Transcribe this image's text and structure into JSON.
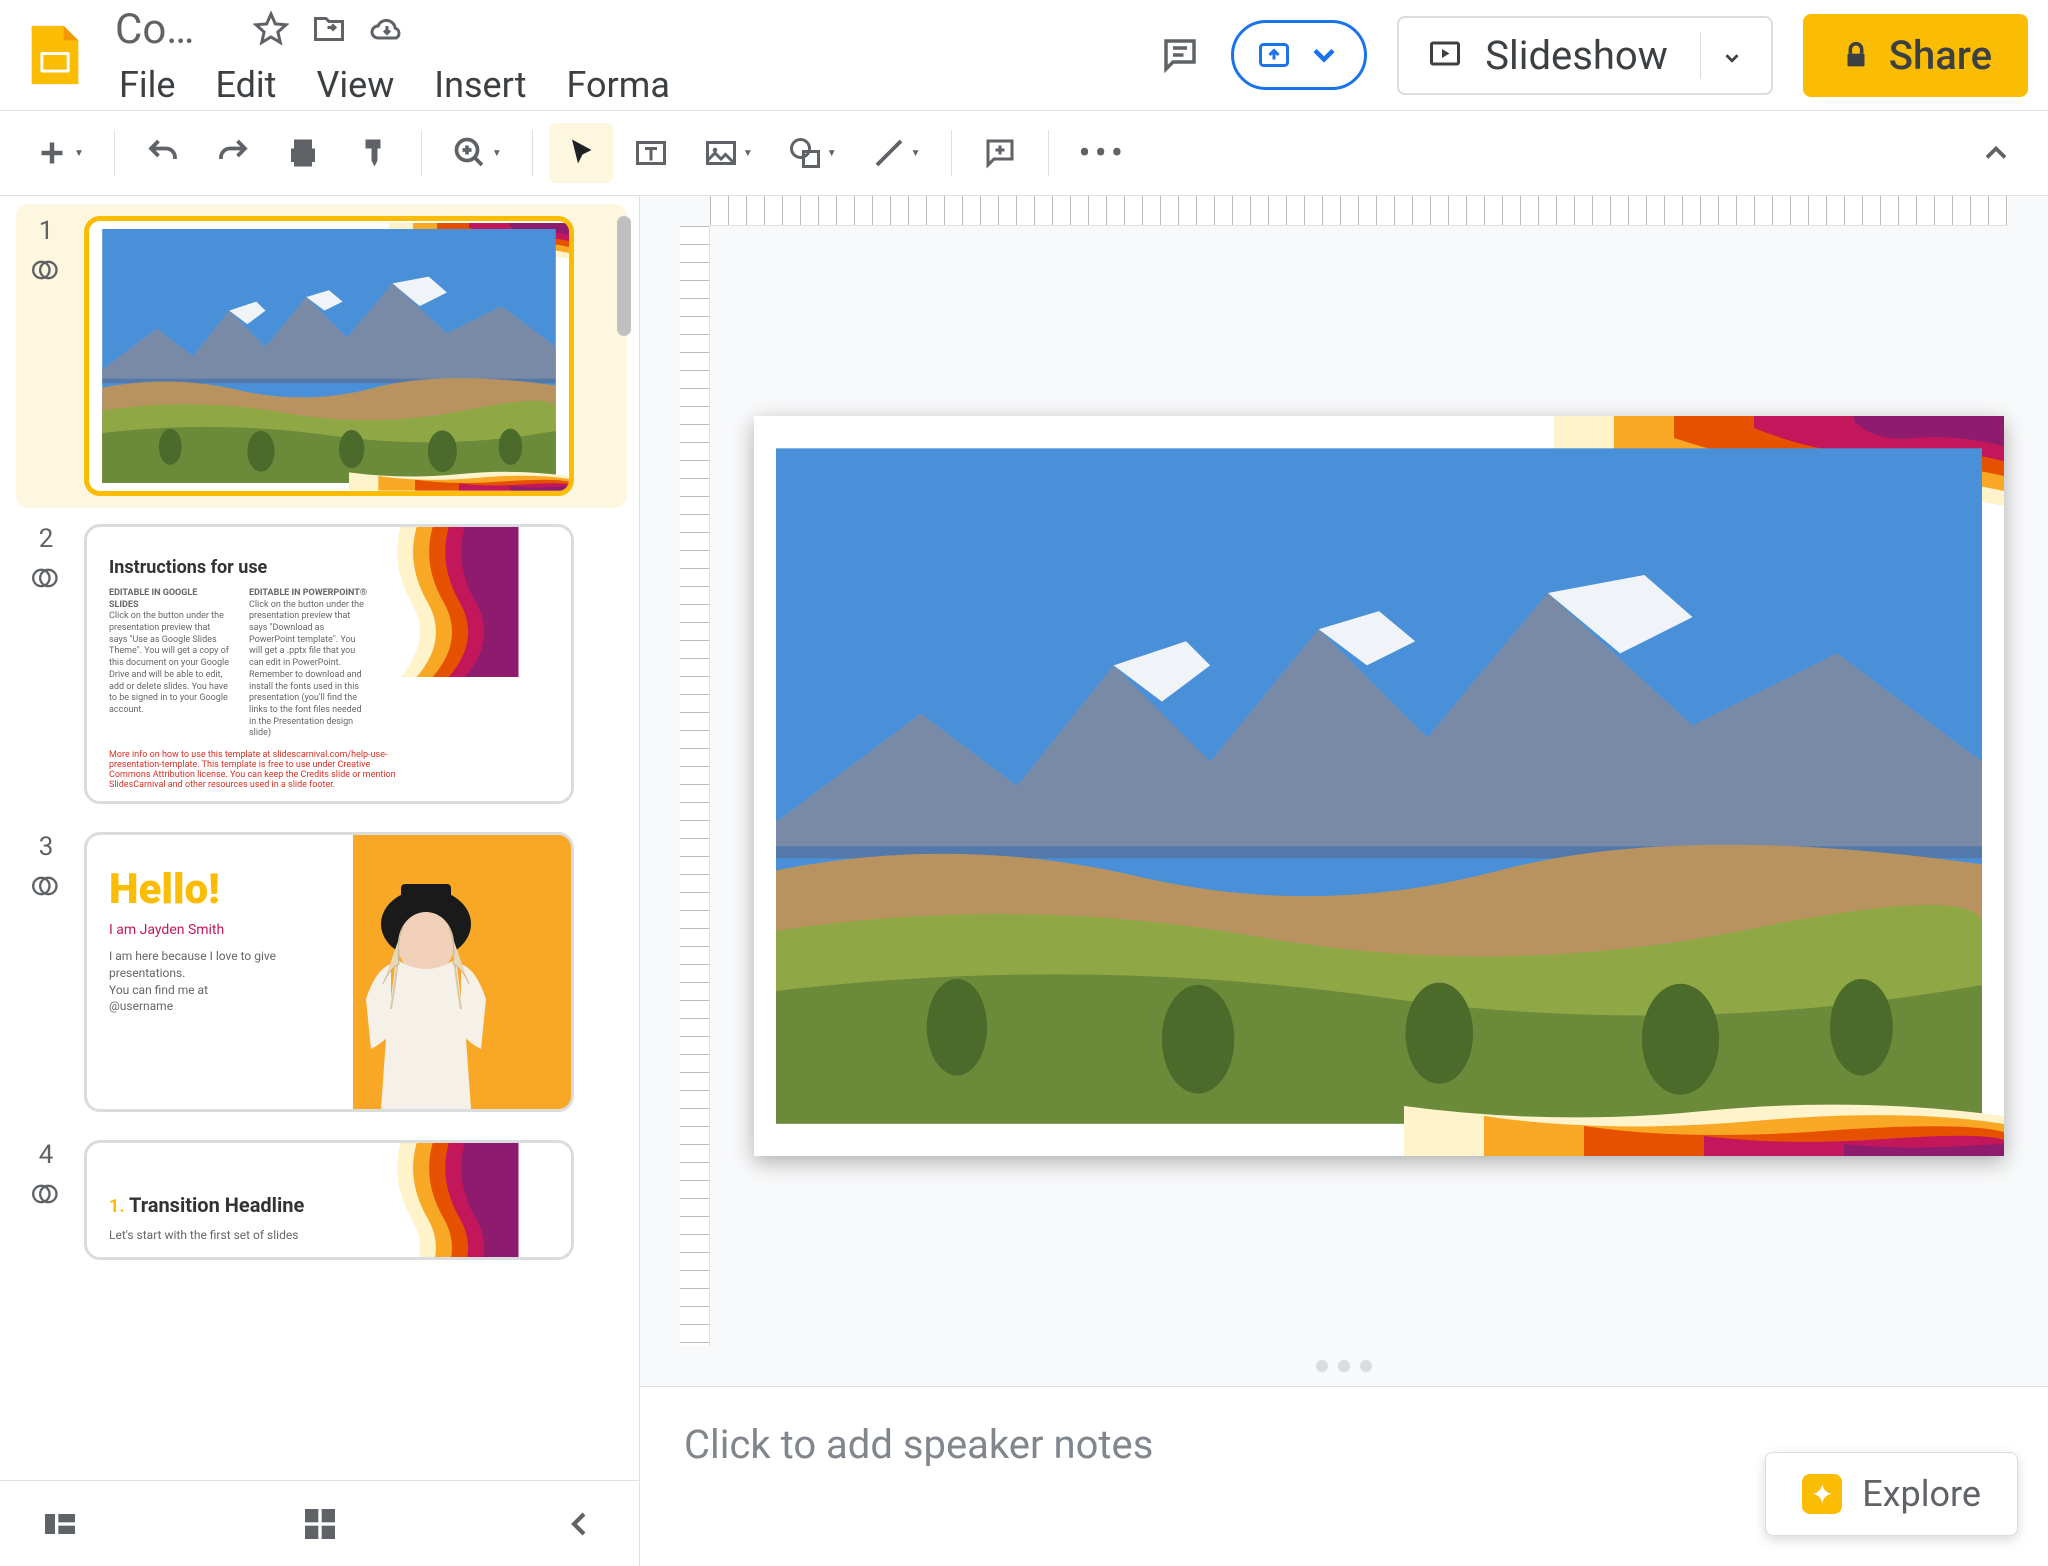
{
  "header": {
    "doc_title": "Co…",
    "menus": [
      "File",
      "Edit",
      "View",
      "Insert",
      "Forma"
    ],
    "slideshow_label": "Slideshow",
    "share_label": "Share"
  },
  "toolbar": {
    "items": [
      "new-slide",
      "undo",
      "redo",
      "print",
      "paint-format",
      "zoom",
      "cursor",
      "text-box",
      "image",
      "shape",
      "line",
      "comment",
      "more"
    ]
  },
  "slides": [
    {
      "num": "1",
      "has_animation": true,
      "type": "photo"
    },
    {
      "num": "2",
      "has_animation": true,
      "type": "instructions",
      "title": "Instructions for use",
      "col1_head": "EDITABLE IN GOOGLE SLIDES",
      "col2_head": "EDITABLE IN POWERPOINT®",
      "col1_body": "Click on the button under the presentation preview that says \"Use as Google Slides Theme\". You will get a copy of this document on your Google Drive and will be able to edit, add or delete slides. You have to be signed in to your Google account.",
      "col2_body": "Click on the button under the presentation preview that says \"Download as PowerPoint template\". You will get a .pptx file that you can edit in PowerPoint. Remember to download and install the fonts used in this presentation (you'll find the links to the font files needed in the Presentation design slide)",
      "footer": "More info on how to use this template at slidescarnival.com/help-use-presentation-template. This template is free to use under Creative Commons Attribution license. You can keep the Credits slide or mention SlidesCarnival and other resources used in a slide footer."
    },
    {
      "num": "3",
      "has_animation": true,
      "type": "hello",
      "hello": "Hello!",
      "name": "I am Jayden Smith",
      "body1": "I am here because I love to give presentations.",
      "body2": "You can find me at",
      "handle": "@username"
    },
    {
      "num": "4",
      "has_animation": true,
      "type": "transition",
      "num_label": "1.",
      "title": "Transition Headline",
      "sub": "Let's start with the first set of slides"
    }
  ],
  "selected_slide": 0,
  "speaker_notes_placeholder": "Click to add speaker notes",
  "explore_label": "Explore",
  "colors": {
    "accent": "#fbbc04",
    "wave1": "#fff3cc",
    "wave2": "#f9a825",
    "wave3": "#e65100",
    "wave4": "#c2185b",
    "wave5": "#8e1b6e"
  }
}
